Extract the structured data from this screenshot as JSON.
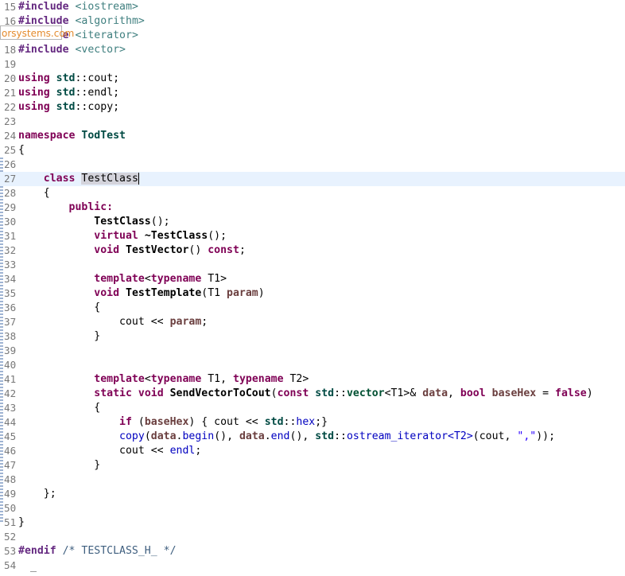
{
  "watermark": "orsystems.com",
  "lines": [
    {
      "n": "15",
      "t": [
        [
          "#include",
          "pr"
        ],
        [
          " "
        ],
        [
          "<iostream>",
          "ac"
        ]
      ]
    },
    {
      "n": "16",
      "t": [
        [
          "#include",
          "pr"
        ],
        [
          " "
        ],
        [
          "<algorithm>",
          "ac"
        ]
      ]
    },
    {
      "n": "17",
      "t": [
        [
          "#include",
          "pr"
        ],
        [
          " "
        ],
        [
          "<iterator>",
          "ac"
        ]
      ]
    },
    {
      "n": "18",
      "t": [
        [
          "#include",
          "pr"
        ],
        [
          " "
        ],
        [
          "<vector>",
          "ac"
        ]
      ]
    },
    {
      "n": "19",
      "t": []
    },
    {
      "n": "20",
      "t": [
        [
          "using",
          "kw"
        ],
        [
          " "
        ],
        [
          "std",
          "ns"
        ],
        [
          "::"
        ],
        [
          "cout",
          "kw2"
        ],
        [
          ";"
        ]
      ]
    },
    {
      "n": "21",
      "t": [
        [
          "using",
          "kw"
        ],
        [
          " "
        ],
        [
          "std",
          "ns"
        ],
        [
          "::"
        ],
        [
          "endl",
          "kw2"
        ],
        [
          ";"
        ]
      ]
    },
    {
      "n": "22",
      "t": [
        [
          "using",
          "kw"
        ],
        [
          " "
        ],
        [
          "std",
          "ns"
        ],
        [
          "::"
        ],
        [
          "copy",
          "kw2"
        ],
        [
          ";"
        ]
      ]
    },
    {
      "n": "23",
      "t": []
    },
    {
      "n": "24",
      "t": [
        [
          "namespace",
          "kw"
        ],
        [
          " "
        ],
        [
          "TodTest",
          "ns"
        ]
      ]
    },
    {
      "n": "25",
      "t": [
        [
          "{"
        ]
      ]
    },
    {
      "n": "26",
      "t": []
    },
    {
      "n": "27",
      "current": true,
      "t": [
        [
          "    "
        ],
        [
          "class",
          "kw"
        ],
        [
          " "
        ],
        [
          "TestClass",
          "sel"
        ],
        [
          "",
          "caret"
        ]
      ]
    },
    {
      "n": "28",
      "t": [
        [
          "    {"
        ]
      ]
    },
    {
      "n": "29",
      "t": [
        [
          "        "
        ],
        [
          "public:",
          "kw"
        ]
      ]
    },
    {
      "n": "30",
      "t": [
        [
          "            "
        ],
        [
          "TestClass",
          "id"
        ],
        [
          "();"
        ]
      ]
    },
    {
      "n": "31",
      "t": [
        [
          "            "
        ],
        [
          "virtual",
          "kw"
        ],
        [
          " "
        ],
        [
          "~TestClass",
          "id"
        ],
        [
          "();"
        ]
      ]
    },
    {
      "n": "32",
      "t": [
        [
          "            "
        ],
        [
          "void",
          "kw"
        ],
        [
          " "
        ],
        [
          "TestVector",
          "id"
        ],
        [
          "() "
        ],
        [
          "const",
          "kw"
        ],
        [
          ";"
        ]
      ]
    },
    {
      "n": "33",
      "t": []
    },
    {
      "n": "34",
      "t": [
        [
          "            "
        ],
        [
          "template",
          "kw"
        ],
        [
          "<"
        ],
        [
          "typename",
          "kw"
        ],
        [
          " T1>"
        ]
      ]
    },
    {
      "n": "35",
      "t": [
        [
          "            "
        ],
        [
          "void",
          "kw"
        ],
        [
          " "
        ],
        [
          "TestTemplate",
          "id"
        ],
        [
          "(T1 "
        ],
        [
          "param",
          "va"
        ],
        [
          ")"
        ]
      ]
    },
    {
      "n": "36",
      "t": [
        [
          "            {"
        ]
      ]
    },
    {
      "n": "37",
      "t": [
        [
          "                cout << "
        ],
        [
          "param",
          "va"
        ],
        [
          ";"
        ]
      ]
    },
    {
      "n": "38",
      "t": [
        [
          "            }"
        ]
      ]
    },
    {
      "n": "39",
      "t": []
    },
    {
      "n": "40",
      "t": []
    },
    {
      "n": "41",
      "t": [
        [
          "            "
        ],
        [
          "template",
          "kw"
        ],
        [
          "<"
        ],
        [
          "typename",
          "kw"
        ],
        [
          " T1, "
        ],
        [
          "typename",
          "kw"
        ],
        [
          " T2>"
        ]
      ]
    },
    {
      "n": "42",
      "t": [
        [
          "            "
        ],
        [
          "static",
          "kw"
        ],
        [
          " "
        ],
        [
          "void",
          "kw"
        ],
        [
          " "
        ],
        [
          "SendVectorToCout",
          "id"
        ],
        [
          "("
        ],
        [
          "const",
          "kw"
        ],
        [
          " "
        ],
        [
          "std",
          "ns"
        ],
        [
          "::"
        ],
        [
          "vector",
          "mt"
        ],
        [
          "<T1>& "
        ],
        [
          "data",
          "va"
        ],
        [
          ", "
        ],
        [
          "bool",
          "kw"
        ],
        [
          " "
        ],
        [
          "baseHex",
          "va"
        ],
        [
          " = "
        ],
        [
          "false",
          "kw"
        ],
        [
          ")"
        ]
      ]
    },
    {
      "n": "43",
      "t": [
        [
          "            {"
        ]
      ]
    },
    {
      "n": "44",
      "t": [
        [
          "                "
        ],
        [
          "if",
          "kw"
        ],
        [
          " ("
        ],
        [
          "baseHex",
          "va"
        ],
        [
          ") { cout << "
        ],
        [
          "std",
          "ns"
        ],
        [
          "::"
        ],
        [
          "hex",
          "sf"
        ],
        [
          ";}"
        ]
      ]
    },
    {
      "n": "45",
      "t": [
        [
          "                "
        ],
        [
          "copy",
          "sf"
        ],
        [
          "("
        ],
        [
          "data",
          "va"
        ],
        [
          "."
        ],
        [
          "begin",
          "sf"
        ],
        [
          "(), "
        ],
        [
          "data",
          "va"
        ],
        [
          "."
        ],
        [
          "end",
          "sf"
        ],
        [
          "(), "
        ],
        [
          "std",
          "ns"
        ],
        [
          "::"
        ],
        [
          "ostream_iterator",
          "mt2"
        ],
        [
          "<T2>",
          "mt2"
        ],
        [
          "(cout, "
        ],
        [
          "\",\"",
          "st"
        ],
        [
          "));"
        ]
      ]
    },
    {
      "n": "46",
      "t": [
        [
          "                cout << "
        ],
        [
          "endl",
          "sf"
        ],
        [
          ";"
        ]
      ]
    },
    {
      "n": "47",
      "t": [
        [
          "            }"
        ]
      ]
    },
    {
      "n": "48",
      "t": []
    },
    {
      "n": "49",
      "t": [
        [
          "    };"
        ]
      ]
    },
    {
      "n": "50",
      "t": []
    },
    {
      "n": "51",
      "t": [
        [
          "}"
        ]
      ]
    },
    {
      "n": "52",
      "t": []
    },
    {
      "n": "53",
      "t": [
        [
          "#endif",
          "pr"
        ],
        [
          " "
        ],
        [
          "/* TESTCLASS_H_ */",
          "cm"
        ]
      ]
    },
    {
      "n": "54",
      "t": []
    }
  ]
}
